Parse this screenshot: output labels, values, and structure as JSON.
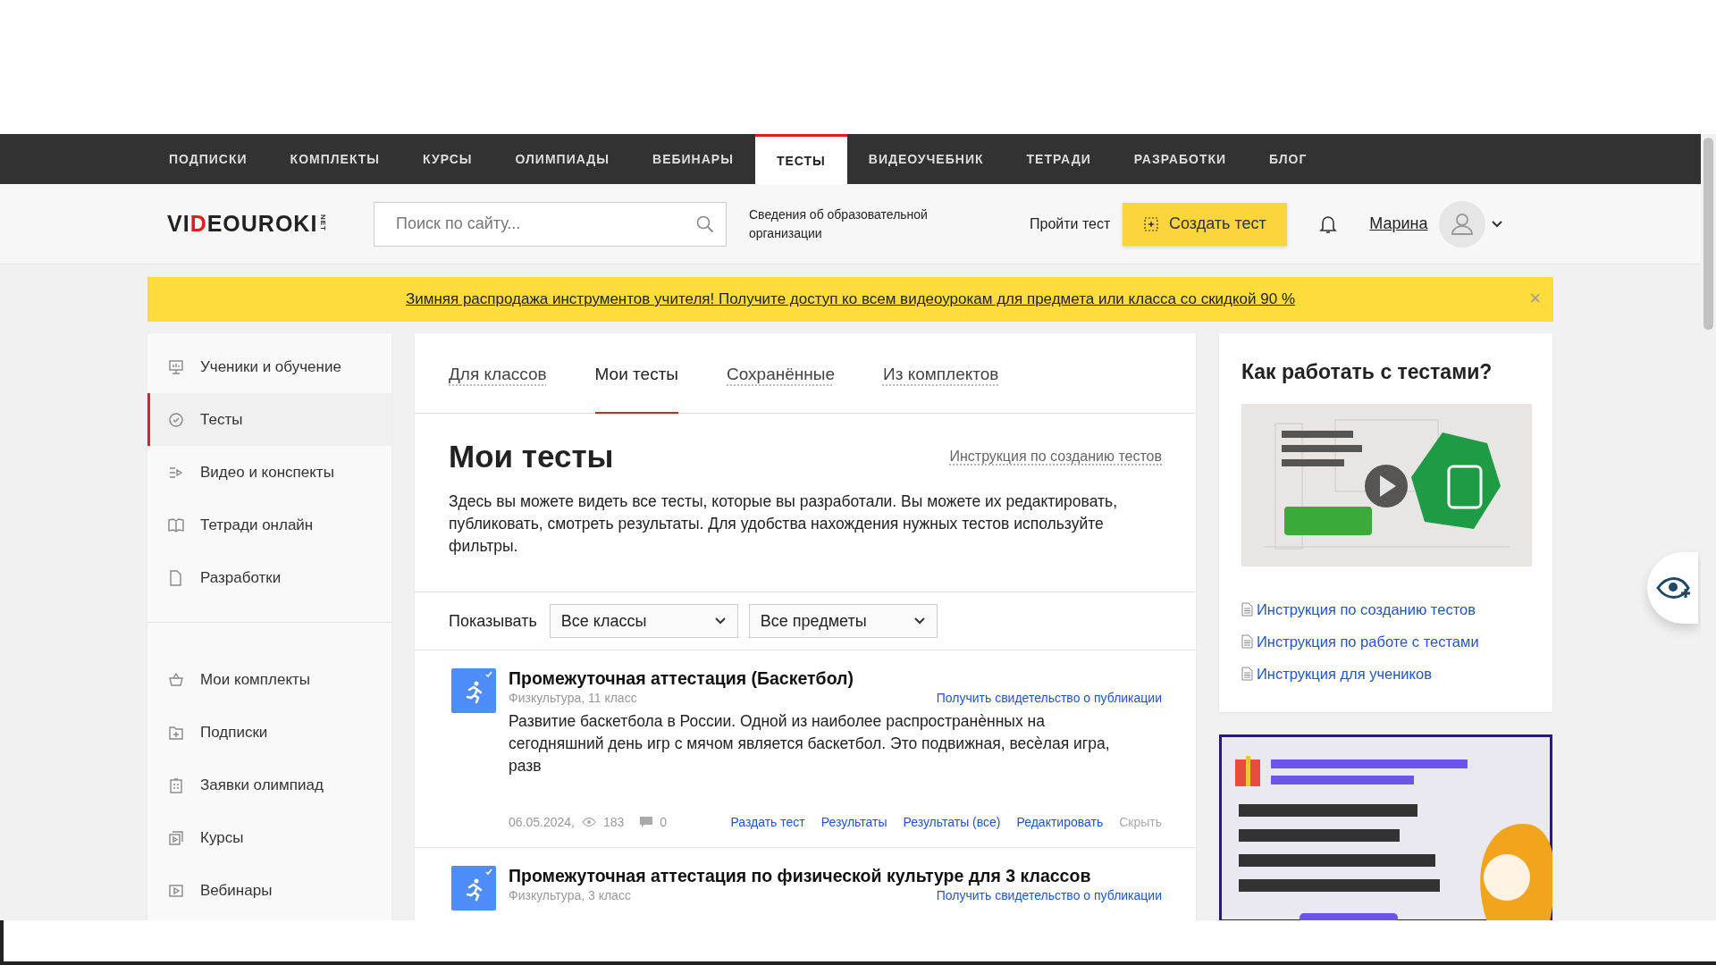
{
  "top_nav": [
    {
      "label": "ПОДПИСКИ",
      "selected": false
    },
    {
      "label": "КОМПЛЕКТЫ",
      "selected": false
    },
    {
      "label": "КУРСЫ",
      "selected": false
    },
    {
      "label": "ОЛИМПИАДЫ",
      "selected": false
    },
    {
      "label": "ВЕБИНАРЫ",
      "selected": false
    },
    {
      "label": "ТЕСТЫ",
      "selected": true
    },
    {
      "label": "ВИДЕОУЧЕБНИК",
      "selected": false
    },
    {
      "label": "ТЕТРАДИ",
      "selected": false
    },
    {
      "label": "РАЗРАБОТКИ",
      "selected": false
    },
    {
      "label": "БЛОГ",
      "selected": false
    }
  ],
  "header": {
    "logo": [
      {
        "text": "VI",
        "accent": false
      },
      {
        "text": "D",
        "accent": true
      },
      {
        "text": "EOUROKI",
        "accent": false
      }
    ],
    "logo_suffix": "NET",
    "search": {
      "placeholder": "Поиск по сайту..."
    },
    "org_info": "Сведения об образовательной организации",
    "take_test": "Пройти тест",
    "create_button": "Создать тест",
    "user_name": "Марина"
  },
  "banner": {
    "text": "Зимняя распродажа инструментов учителя! Получите доступ ко всем видеоурокам для предмета или класса со скидкой 90 %",
    "close": "×"
  },
  "sidebar": {
    "groups": [
      [
        {
          "label": "Ученики и обучение",
          "selected": false
        },
        {
          "label": "Тесты",
          "selected": true
        },
        {
          "label": "Видео и конспекты",
          "selected": false
        },
        {
          "label": "Тетради онлайн",
          "selected": false
        },
        {
          "label": "Разработки",
          "selected": false
        }
      ],
      [
        {
          "label": "Мои комплекты",
          "selected": false
        },
        {
          "label": "Подписки",
          "selected": false
        },
        {
          "label": "Заявки олимпиад",
          "selected": false
        },
        {
          "label": "Курсы",
          "selected": false
        },
        {
          "label": "Вебинары",
          "selected": false
        }
      ]
    ]
  },
  "main": {
    "tabs": [
      {
        "label": "Для классов",
        "selected": false
      },
      {
        "label": "Мои тесты",
        "selected": true
      },
      {
        "label": "Сохранённые",
        "selected": false
      },
      {
        "label": "Из комплектов",
        "selected": false
      }
    ],
    "heading": "Мои тесты",
    "instruction_link": "Инструкция по созданию тестов",
    "description": "Здесь вы можете видеть все тесты, которые вы разработали. Вы можете их редактировать, публиковать, смотреть результаты. Для удобства нахождения нужных тестов используйте фильтры.",
    "filters": {
      "label": "Показывать",
      "selects": [
        {
          "value": "Все классы"
        },
        {
          "value": "Все предметы"
        }
      ]
    },
    "tests": [
      {
        "title": "Промежуточная аттестация (Баскетбол)",
        "meta": "Физкультура, 11 класс",
        "certificate_link": "Получить свидетельство о публикации",
        "description": "Развитие баскетбола в России. Одной из наиболее распространѐнных на сегодняшний день игр с мячом является баскетбол. Это подвижная, весѐлая игра, разв",
        "date": "06.05.2024,",
        "views": "183",
        "comments": "0",
        "actions": [
          {
            "label": "Раздать тест",
            "muted": false
          },
          {
            "label": "Результаты",
            "muted": false
          },
          {
            "label": "Результаты (все)",
            "muted": false
          },
          {
            "label": "Редактировать",
            "muted": false
          },
          {
            "label": "Скрыть",
            "muted": true
          }
        ]
      },
      {
        "title": "Промежуточная аттестация по физической культуре для 3 классов",
        "meta": "Физкультура, 3 класс",
        "certificate_link": "Получить свидетельство о публикации"
      }
    ]
  },
  "help": {
    "title": "Как работать с тестами?",
    "video": {
      "kind": "picture"
    },
    "links": [
      "Инструкция по созданию тестов",
      "Инструкция по работе с тестами",
      "Инструкция для учеников"
    ]
  },
  "promo": {
    "kind": "picture"
  }
}
